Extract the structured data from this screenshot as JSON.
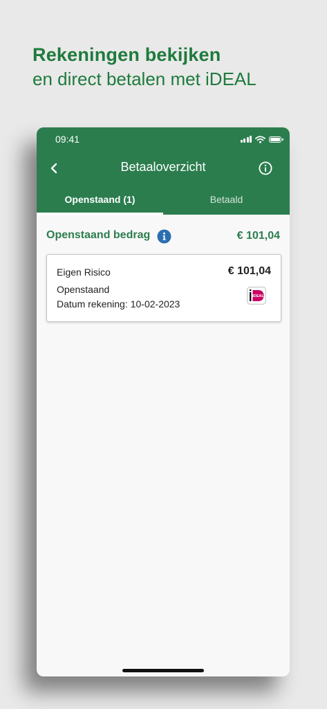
{
  "promo": {
    "headline": "Rekeningen bekijken",
    "subheadline": "en direct betalen met iDEAL"
  },
  "status_bar": {
    "time": "09:41",
    "icons": [
      "signal-icon",
      "wifi-icon",
      "battery-icon"
    ]
  },
  "header": {
    "title": "Betaaloverzicht",
    "back_icon": "chevron-left-icon",
    "info_icon": "info-circle-icon"
  },
  "tabs": [
    {
      "label": "Openstaand (1)",
      "active": true
    },
    {
      "label": "Betaald",
      "active": false
    }
  ],
  "summary": {
    "label": "Openstaand bedrag",
    "amount": "€ 101,04",
    "info_icon": "info-filled-icon"
  },
  "invoices": [
    {
      "title": "Eigen Risico",
      "amount": "€ 101,04",
      "status": "Openstaand",
      "date_label": "Datum rekening:",
      "date": "10-02-2023",
      "pay_method": "iDEAL",
      "pay_icon_text": "iDEAL"
    }
  ],
  "colors": {
    "primary_green": "#2b7d4e",
    "headline_green": "#1f7a3d",
    "info_blue": "#2a6fb0",
    "ideal_pink": "#cc0066"
  }
}
